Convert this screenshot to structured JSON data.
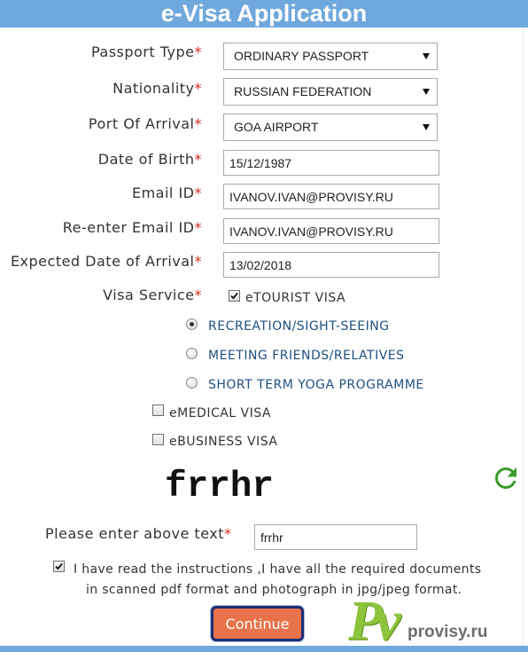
{
  "header": {
    "title": "e-Visa Application"
  },
  "form": {
    "required_marker": "*",
    "passport_type": {
      "label": "Passport Type",
      "value": "ORDINARY PASSPORT"
    },
    "nationality": {
      "label": "Nationality",
      "value": "RUSSIAN FEDERATION"
    },
    "port_of_arrival": {
      "label": "Port Of Arrival",
      "value": "GOA AIRPORT"
    },
    "date_of_birth": {
      "label": "Date of Birth",
      "value": "15/12/1987"
    },
    "email": {
      "label": "Email ID",
      "value": "IVANOV.IVAN@PROVISY.RU"
    },
    "email_confirm": {
      "label": "Re-enter Email ID",
      "value": "IVANOV.IVAN@PROVISY.RU"
    },
    "expected_arrival": {
      "label": "Expected Date of Arrival",
      "value": "13/02/2018"
    },
    "visa_service": {
      "label": "Visa Service",
      "etourist": {
        "label": "eTOURIST VISA",
        "checked": true
      },
      "etourist_purposes": [
        {
          "label": "RECREATION/SIGHT-SEEING",
          "selected": true
        },
        {
          "label": "MEETING FRIENDS/RELATIVES",
          "selected": false
        },
        {
          "label": "SHORT TERM YOGA PROGRAMME",
          "selected": false
        }
      ],
      "emedical": {
        "label": "eMEDICAL VISA",
        "checked": false
      },
      "ebusiness": {
        "label": "eBUSINESS VISA",
        "checked": false
      }
    },
    "captcha": {
      "image_text": "frrhr",
      "prompt": "Please enter above text",
      "value": "frrhr"
    },
    "agreement": {
      "checked": true,
      "lines": [
        "I have read the instructions ,I have all the required documents",
        "in scanned pdf format and photograph in jpg/jpeg format."
      ]
    }
  },
  "actions": {
    "continue_label": "Continue"
  },
  "watermark": {
    "mark": "Pv",
    "site": "provisy.ru"
  },
  "icons": {
    "dropdown": "chevron-down-icon",
    "refresh": "refresh-icon",
    "checkbox_checked": "check-icon",
    "radio_selected": "radio-dot"
  },
  "colors": {
    "header": "#6fa8dc",
    "required": "#d62b20",
    "label_text": "#333333",
    "option_text": "#1f4f80",
    "input_border": "#a9a9a9",
    "button": "#e8734b",
    "button_border": "#1c2d74",
    "refresh": "#3b9b2c",
    "watermark_green": "#8cc43c",
    "watermark_gray": "#6d6e71"
  }
}
